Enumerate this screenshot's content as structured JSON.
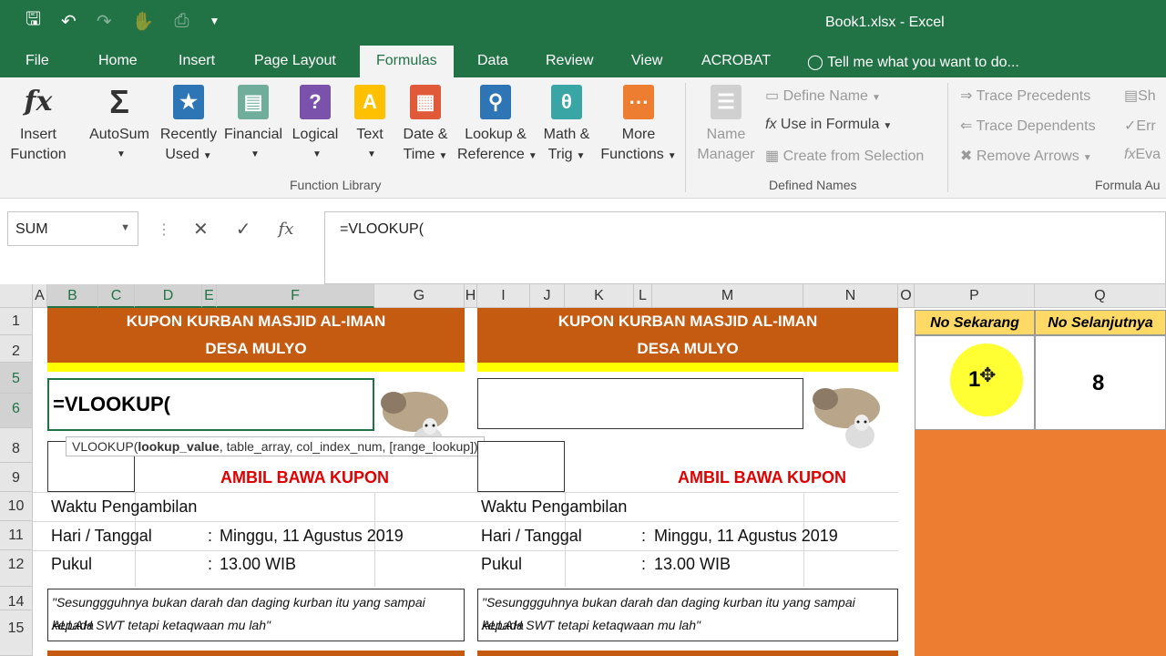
{
  "window": {
    "title": "Book1.xlsx - Excel"
  },
  "quick_access": {
    "icons": [
      "save-icon",
      "undo-icon",
      "redo-icon",
      "touch-mode-icon",
      "print-preview-icon",
      "customize-icon"
    ]
  },
  "tabs": [
    "File",
    "Home",
    "Insert",
    "Page Layout",
    "Formulas",
    "Data",
    "Review",
    "View",
    "ACROBAT"
  ],
  "active_tab": "Formulas",
  "tell_me": "Tell me what you want to do...",
  "ribbon": {
    "insert_function": [
      "Insert",
      "Function"
    ],
    "autosum": "AutoSum",
    "recently_used": [
      "Recently",
      "Used"
    ],
    "financial": "Financial",
    "logical": "Logical",
    "text": "Text",
    "date_time": [
      "Date &",
      "Time"
    ],
    "lookup_reference": [
      "Lookup &",
      "Reference"
    ],
    "math_trig": [
      "Math &",
      "Trig"
    ],
    "more_functions": [
      "More",
      "Functions"
    ],
    "function_library_label": "Function Library",
    "name_manager": [
      "Name",
      "Manager"
    ],
    "define_name": "Define Name",
    "use_in_formula": "Use in Formula",
    "create_from_selection": "Create from Selection",
    "defined_names_label": "Defined Names",
    "trace_precedents": "Trace Precedents",
    "trace_dependents": "Trace Dependents",
    "remove_arrows": "Remove Arrows",
    "formula_auditing_label": "Formula Au",
    "show_partial": "Sh",
    "error_partial": "Err",
    "eval_partial": "Eva"
  },
  "formula_bar": {
    "name_box": "SUM",
    "content": "=VLOOKUP("
  },
  "columns": [
    "A",
    "B",
    "C",
    "D",
    "E",
    "F",
    "G",
    "H",
    "I",
    "J",
    "K",
    "L",
    "M",
    "N",
    "O",
    "P",
    "Q"
  ],
  "rows": [
    "1",
    "2",
    "5",
    "6",
    "8",
    "9",
    "10",
    "11",
    "12",
    "14",
    "15"
  ],
  "sheet": {
    "title_line1": "KUPON  KURBAN MASJID AL-IMAN",
    "title_line2": "DESA MULYO",
    "active_cell_text": "=VLOOKUP(",
    "tooltip_prefix": "VLOOKUP(",
    "tooltip_bold": "lookup_value",
    "tooltip_rest": ", table_array, col_index_num, [range_lookup])",
    "ambil": "AMBIL BAWA KUPON",
    "waktu": "Waktu Pengambilan",
    "hari": "Hari / Tanggal",
    "colon": ":",
    "tanggal": "Minggu, 11 Agustus 2019",
    "pukul": "Pukul",
    "jam": "13.00 WIB",
    "quote_line1": "\"Sesunggguhnya bukan darah dan daging kurban itu yang sampai kepada",
    "quote_line2": "ALLAH SWT tetapi ketaqwaan mu lah\"",
    "no_sekarang": "No Sekarang",
    "no_selanjutnya": "No Selanjutnya",
    "no_sekarang_value": "1",
    "no_selanjutnya_value": "8"
  },
  "colors": {
    "excel_green": "#217346",
    "orange_header": "#c55a11",
    "orange_fill": "#ed7d31",
    "yellow": "#ffff00",
    "label_yellow": "#ffd966",
    "red_text": "#e00000"
  }
}
